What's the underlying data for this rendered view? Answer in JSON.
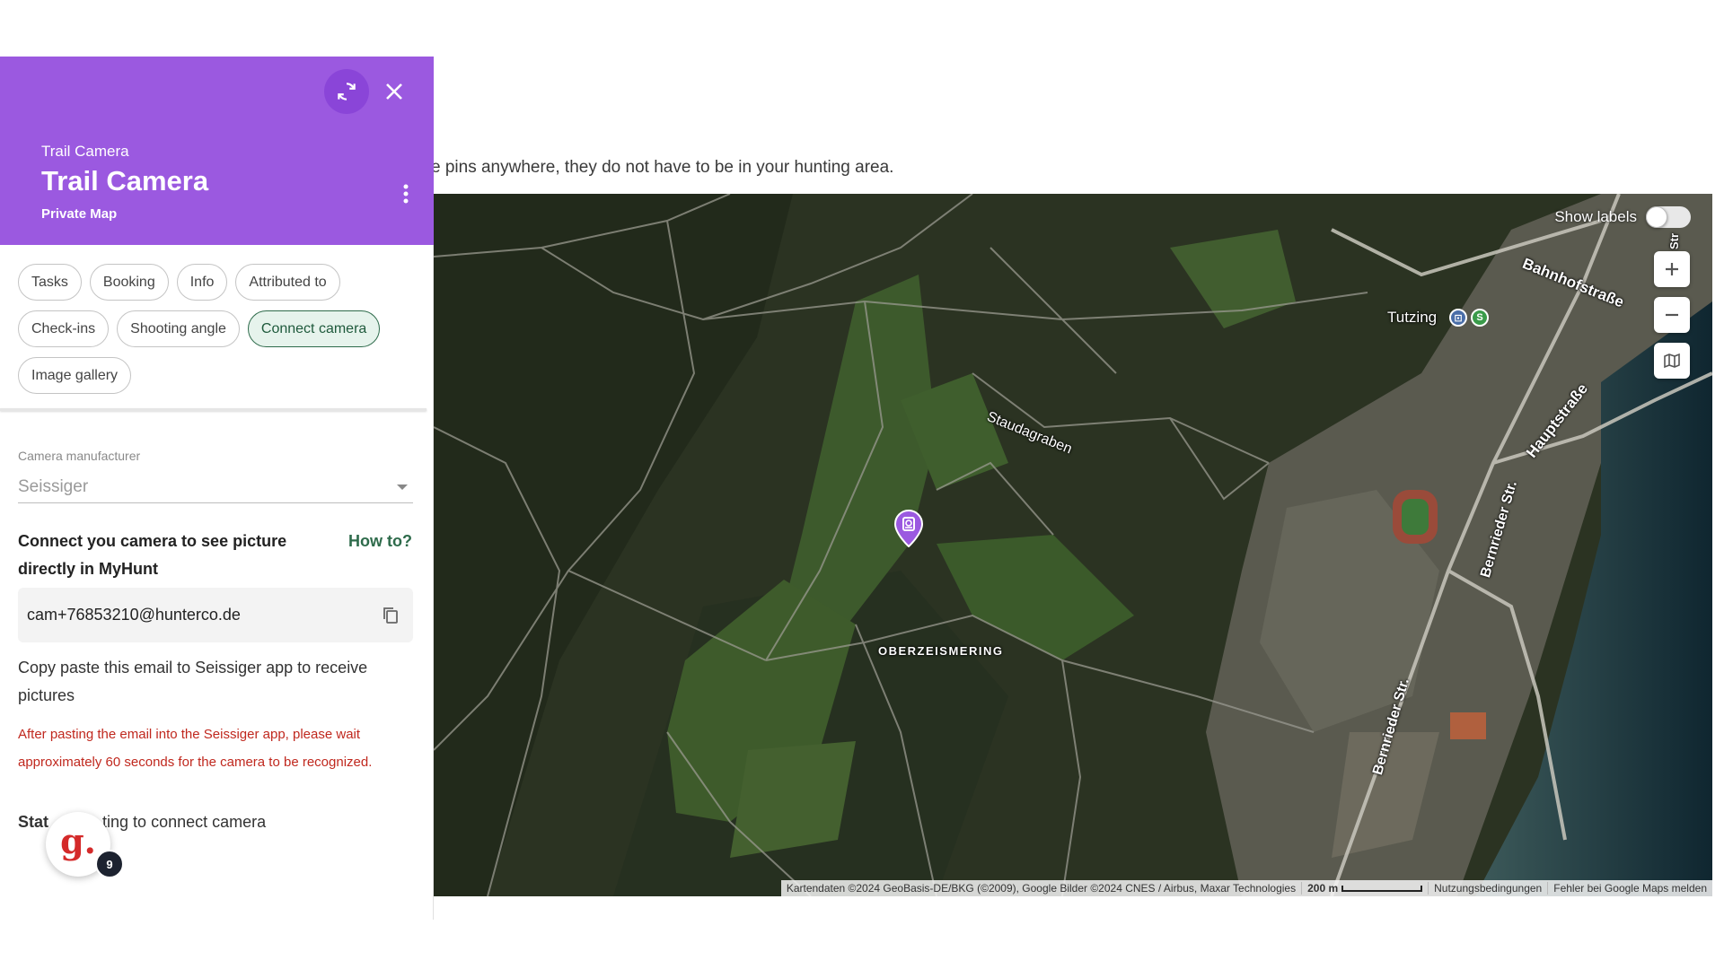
{
  "page": {
    "hint_text": "e pins anywhere, they do not have to be in your hunting area."
  },
  "panel": {
    "header": {
      "eyebrow": "Trail Camera",
      "title": "Trail Camera",
      "subtitle": "Private Map",
      "background_color": "#9b59e0"
    },
    "chips": [
      {
        "label": "Tasks",
        "active": false
      },
      {
        "label": "Booking",
        "active": false
      },
      {
        "label": "Info",
        "active": false
      },
      {
        "label": "Attributed to",
        "active": false
      },
      {
        "label": "Check-ins",
        "active": false
      },
      {
        "label": "Shooting angle",
        "active": false
      },
      {
        "label": "Connect camera",
        "active": true
      },
      {
        "label": "Image gallery",
        "active": false
      }
    ],
    "manufacturer": {
      "label": "Camera manufacturer",
      "value": "Seissiger"
    },
    "connect": {
      "title": "Connect you camera to see picture directly in MyHunt",
      "howto_label": "How to?",
      "email": "cam+76853210@hunterco.de",
      "copy_help": "Copy paste this email to Seissiger app to receive pictures",
      "warning": "After pasting the email into the Seissiger app, please wait approximately 60 seconds for the camera to be recognized."
    },
    "status": {
      "label": "Stat",
      "value": "ting to connect camera"
    },
    "widget": {
      "letter": "g.",
      "badge_count": "9"
    }
  },
  "map": {
    "show_labels_text": "Show labels",
    "show_labels_on": false,
    "labels": {
      "bahnhofstrasse": "Bahnhofstraße",
      "tutzing": "Tutzing",
      "staudagraben": "Staudagraben",
      "hauptstrasse": "Hauptstraße",
      "bernrieder_1": "Bernrieder Str.",
      "bernrieder_2": "Bernrieder Str.",
      "oberzeismering": "OBERZEISMERING",
      "str_partial": "Str"
    },
    "station_badges": {
      "train": "⊡",
      "s_bahn": "S"
    },
    "attribution": {
      "data": "Kartendaten ©2024 GeoBasis-DE/BKG (©2009), Google Bilder ©2024 CNES / Airbus, Maxar Technologies",
      "scale": "200 m",
      "terms": "Nutzungsbedingungen",
      "report": "Fehler bei Google Maps melden"
    },
    "controls": {
      "zoom_in_icon": "plus-icon",
      "zoom_out_icon": "minus-icon",
      "map_type_icon": "map-layers-icon"
    },
    "pin_color": "#9b59e0"
  }
}
